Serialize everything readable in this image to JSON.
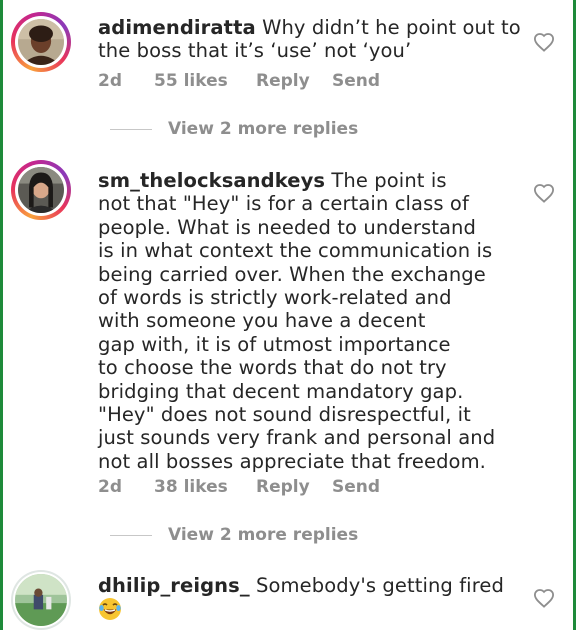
{
  "comments": [
    {
      "username": "adimendiratta",
      "text_lines": [
        "Why didn’t he point out to",
        "the boss that it’s ‘use’ not ‘you’"
      ],
      "age": "2d",
      "likes": "55 likes",
      "reply_label": "Reply",
      "send_label": "Send",
      "more_replies": "View 2 more replies"
    },
    {
      "username": "sm_thelocksandkeys",
      "text_lines": [
        "The point is",
        "not that \"Hey\" is for a certain class of",
        "people. What is needed to understand",
        "is in what context the communication is",
        "being carried over. When the exchange",
        "of words is strictly work-related and",
        "with someone you have a decent",
        "gap with, it is of utmost importance",
        "to choose the words that do not try",
        "bridging that decent mandatory gap.",
        "\"Hey\" does not sound disrespectful, it",
        "just sounds very frank and personal and",
        "not all bosses appreciate that freedom."
      ],
      "age": "2d",
      "likes": "38 likes",
      "reply_label": "Reply",
      "send_label": "Send",
      "more_replies": "View 2 more replies"
    },
    {
      "username": "dhilip_reigns_",
      "text_lines": [
        "Somebody's getting fired"
      ],
      "emoji": "😂"
    }
  ],
  "icons": {
    "like": "heart-outline-icon",
    "emoji": "face-with-tears-of-joy"
  },
  "colors": {
    "text": "#262626",
    "meta": "#8e8e8e",
    "frame_border": "#1e8a3a",
    "story_ring": [
      "#f9a23c",
      "#e8335b",
      "#c3268f",
      "#8a3ab9"
    ]
  }
}
